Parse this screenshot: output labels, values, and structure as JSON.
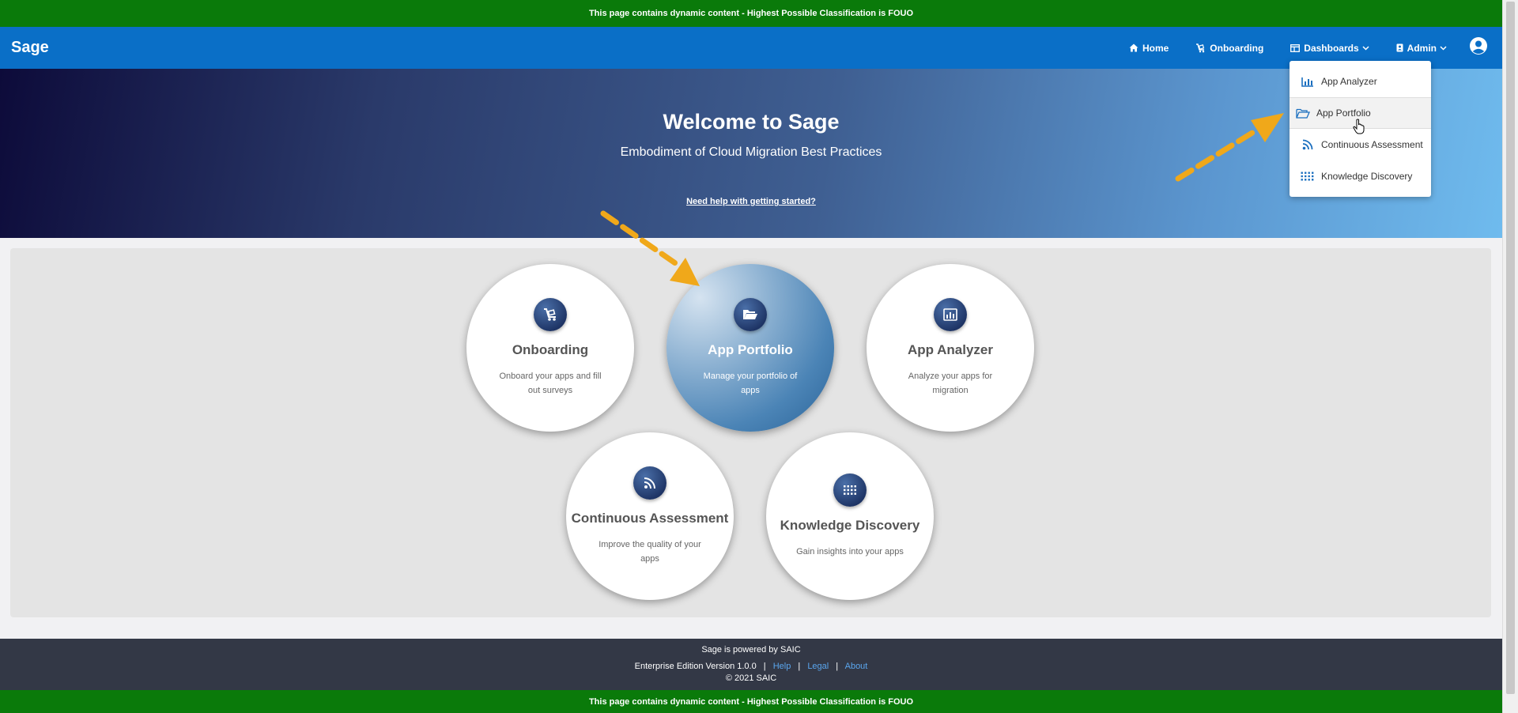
{
  "classification": {
    "text": "This page contains dynamic content - Highest Possible Classification is",
    "level": "FOUO"
  },
  "navbar": {
    "brand": "Sage",
    "items": [
      {
        "label": "Home",
        "icon": "home-icon"
      },
      {
        "label": "Onboarding",
        "icon": "onboarding-icon"
      },
      {
        "label": "Dashboards",
        "icon": "dashboard-icon"
      },
      {
        "label": "Admin",
        "icon": "admin-icon"
      }
    ],
    "user_icon": "user-circle-icon"
  },
  "dropdown": {
    "items": [
      {
        "label": "App Analyzer",
        "icon": "bar-chart-icon"
      },
      {
        "label": "App Portfolio",
        "icon": "folder-open-icon"
      },
      {
        "label": "Continuous Assessment",
        "icon": "rss-icon"
      },
      {
        "label": "Knowledge Discovery",
        "icon": "grid-dots-icon"
      }
    ]
  },
  "hero": {
    "title": "Welcome to Sage",
    "subtitle": "Embodiment of Cloud Migration Best Practices",
    "help_link": "Need help with getting started?"
  },
  "cards": [
    {
      "title": "Onboarding",
      "description": "Onboard your apps and fill out surveys",
      "icon": "onboarding-icon"
    },
    {
      "title": "App Portfolio",
      "description": "Manage your portfolio of apps",
      "icon": "folder-open-icon"
    },
    {
      "title": "App Analyzer",
      "description": "Analyze your apps for migration",
      "icon": "bar-chart-icon"
    },
    {
      "title": "Continuous Assessment",
      "description": "Improve the quality of your apps",
      "icon": "rss-icon"
    },
    {
      "title": "Knowledge Discovery",
      "description": "Gain insights into your apps",
      "icon": "grid-dots-icon"
    }
  ],
  "footer": {
    "powered_by": "Sage is powered by SAIC",
    "version": "Enterprise Edition Version 1.0.0",
    "links": [
      "Help",
      "Legal",
      "About"
    ],
    "copyright": "© 2021 SAIC"
  },
  "colors": {
    "classification": "#0a7a0a",
    "navbar": "#0a6fc7",
    "footer": "#333846",
    "annotation_arrow": "#f0a81a"
  }
}
